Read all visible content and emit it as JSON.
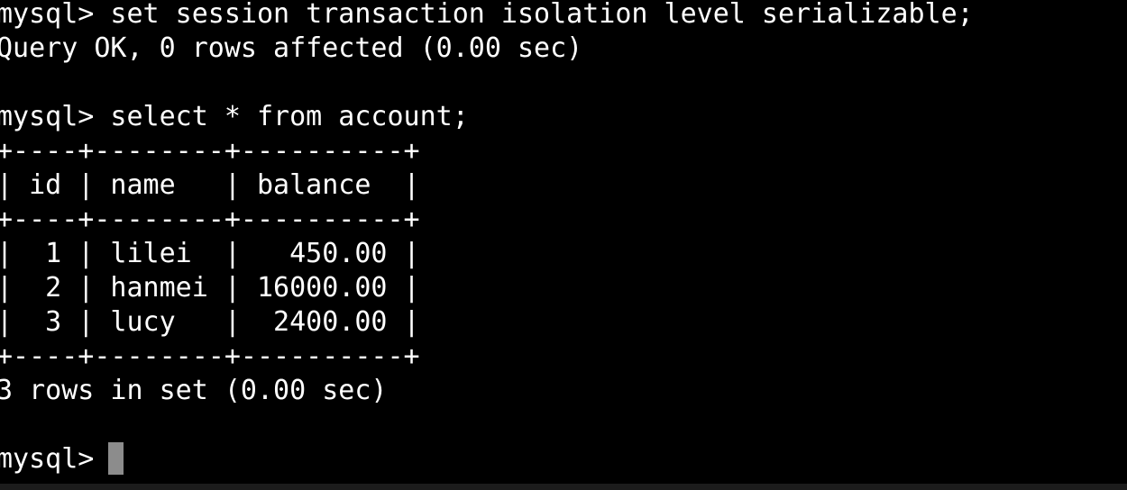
{
  "terminal": {
    "lines": [
      "mysql> set session transaction isolation level serializable;",
      "Query OK, 0 rows affected (0.00 sec)",
      "",
      "mysql> select * from account;",
      "+----+--------+----------+",
      "| id | name   | balance  |",
      "+----+--------+----------+",
      "|  1 | lilei  |   450.00 |",
      "|  2 | hanmei | 16000.00 |",
      "|  3 | lucy   |  2400.00 |",
      "+----+--------+----------+",
      "3 rows in set (0.00 sec)",
      "",
      "mysql> "
    ],
    "colors": {
      "background": "#000000",
      "foreground": "#ffffff",
      "cursor": "#8c8c8c"
    }
  }
}
